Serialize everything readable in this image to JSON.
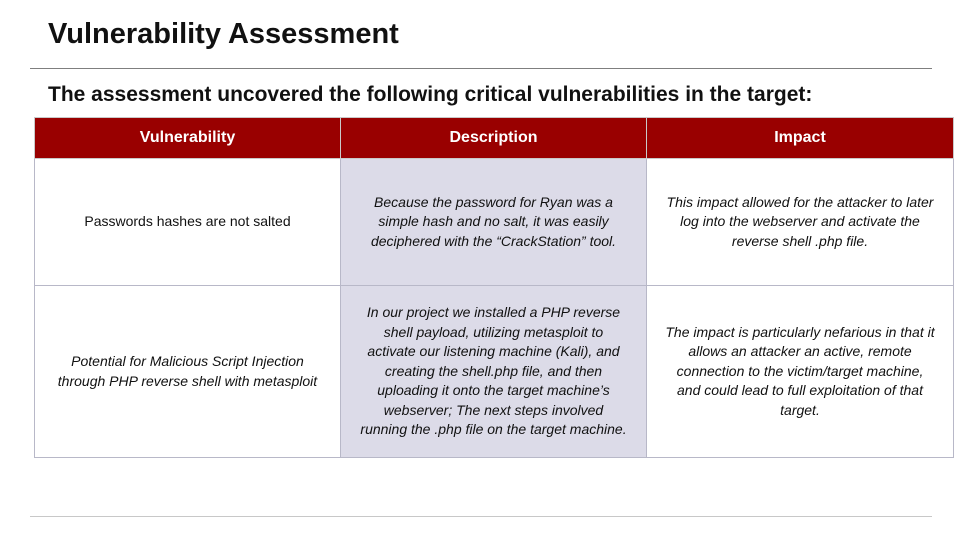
{
  "slide": {
    "title": "Vulnerability Assessment",
    "subtitle": "The assessment uncovered the following critical vulnerabilities in the target:"
  },
  "table": {
    "headers": [
      "Vulnerability",
      "Description",
      "Impact"
    ],
    "rows": [
      {
        "vulnerability": "Passwords hashes are not salted",
        "description": "Because the password for Ryan was a simple hash and no salt, it was easily deciphered with the “CrackStation” tool.",
        "impact": "This impact allowed for the attacker to later log into the webserver and activate the reverse shell .php file."
      },
      {
        "vulnerability": "Potential for Malicious Script Injection through PHP reverse shell with metasploit",
        "description": "In our project we installed a PHP reverse shell payload, utilizing metasploit to activate our listening machine (Kali), and creating the shell.php file, and then uploading it onto the target machine’s webserver; The next steps involved running the .php file on the target machine.",
        "impact": "The impact is particularly nefarious in that it allows an attacker an active, remote connection to the victim/target machine, and could lead to full exploitation of that target."
      }
    ]
  },
  "colors": {
    "header_background": "#990000",
    "description_column_background": "#dcdbe8"
  }
}
